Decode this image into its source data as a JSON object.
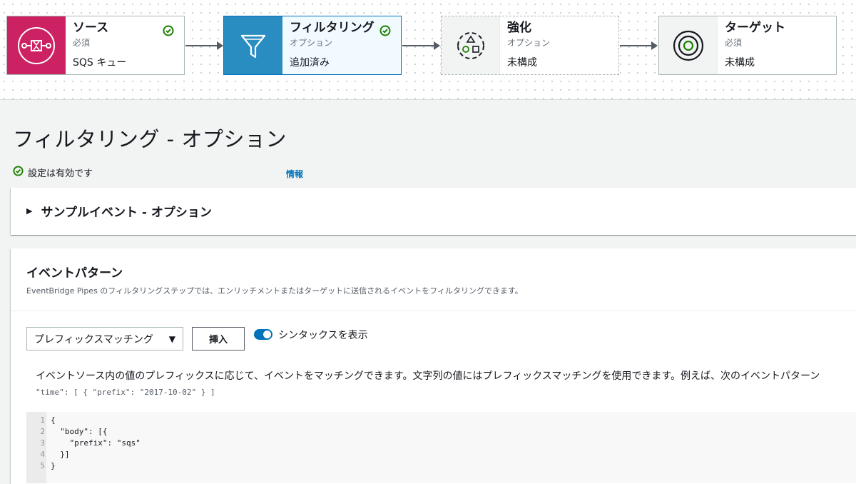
{
  "pipeline": {
    "source": {
      "title": "ソース",
      "sub": "必須",
      "status": "SQS キュー"
    },
    "filter": {
      "title": "フィルタリング",
      "sub": "オプション",
      "status": "追加済み"
    },
    "enrich": {
      "title": "強化",
      "sub": "オプション",
      "status": "未構成"
    },
    "target": {
      "title": "ターゲット",
      "sub": "必須",
      "status": "未構成"
    }
  },
  "page": {
    "title": "フィルタリング - オプション",
    "valid_text": "設定は有効です",
    "info_link": "情報"
  },
  "sample_section": {
    "title": "サンプルイベント - オプション"
  },
  "event_pattern": {
    "title": "イベントパターン",
    "description": "EventBridge Pipes のフィルタリングステップでは、エンリッチメントまたはターゲットに送信されるイベントをフィルタリングできます。",
    "select_value": "プレフィックスマッチング",
    "insert_button": "挿入",
    "toggle_label": "シンタックスを表示",
    "help_text": "イベントソース内の値のプレフィックスに応じて、イベントをマッチングできます。文字列の値にはプレフィックスマッチングを使用できます。例えば、次のイベントパターン",
    "example": "\"time\": [ { \"prefix\": \"2017-10-02\" } ]"
  },
  "editor": {
    "lines": [
      {
        "n": "1",
        "code": "{"
      },
      {
        "n": "2",
        "code": "  \"body\": [{"
      },
      {
        "n": "3",
        "code": "    \"prefix\": \"sqs\""
      },
      {
        "n": "4",
        "code": "  }]"
      },
      {
        "n": "5",
        "code": "}"
      }
    ]
  },
  "colors": {
    "accent": "#0073bb",
    "success": "#1d8102",
    "source_tile": "#cc2264",
    "filter_tile": "#2a8dc2"
  },
  "icons": [
    "sqs-icon",
    "filter-funnel-icon",
    "enrich-shapes-icon",
    "target-icon",
    "check-circle-icon",
    "caret-down-icon",
    "triangle-right-icon"
  ]
}
